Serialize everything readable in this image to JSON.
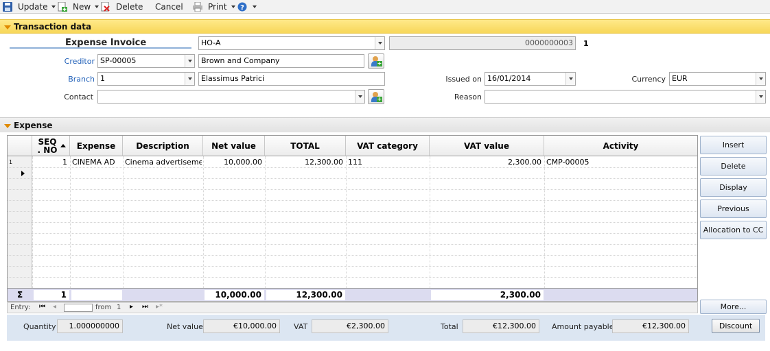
{
  "toolbar": {
    "update_label": "Update",
    "new_label": "New",
    "delete_label": "Delete",
    "cancel_label": "Cancel",
    "print_label": "Print"
  },
  "sections": {
    "transaction": "Transaction data",
    "expense": "Expense"
  },
  "form": {
    "doc_type": "Expense Invoice",
    "series_value": "HO-A",
    "doc_number": "0000000003",
    "doc_number_suffix": "1",
    "creditor_label": "Creditor",
    "creditor_code": "SP-00005",
    "creditor_name": "Brown and Company",
    "branch_label": "Branch",
    "branch_code": "1",
    "branch_name": "Elassimus Patrici",
    "contact_label": "Contact",
    "contact_value": "",
    "issued_on_label": "Issued on",
    "issued_on_value": "16/01/2014",
    "currency_label": "Currency",
    "currency_value": "EUR",
    "reason_label": "Reason",
    "reason_value": ""
  },
  "grid": {
    "columns": [
      "SEQ . NO",
      "Expense",
      "Description",
      "Net value",
      "TOTAL",
      "VAT category",
      "VAT value",
      "Activity"
    ],
    "rows": [
      {
        "row_num": "1",
        "seq": "1",
        "expense": "CINEMA AD",
        "description": "Cinema advertisement",
        "net_value": "10,000.00",
        "total": "12,300.00",
        "vat_category": "111",
        "vat_value": "2,300.00",
        "activity": "CMP-00005"
      }
    ],
    "totals": {
      "sigma": "Σ",
      "seq": "1",
      "net_value": "10,000.00",
      "total": "12,300.00",
      "vat_value": "2,300.00"
    }
  },
  "side_buttons": {
    "insert": "Insert",
    "delete": "Delete",
    "display": "Display",
    "previous": "Previous",
    "allocation": "Allocation to CC",
    "more": "More..."
  },
  "navigator": {
    "entry_label": "Entry:",
    "from_label": "from",
    "count": "1"
  },
  "footer": {
    "quantity_label": "Quantity",
    "quantity_value": "1.000000000",
    "net_label": "Net value",
    "net_value": "€10,000.00",
    "vat_label": "VAT",
    "vat_value": "€2,300.00",
    "total_label": "Total",
    "total_value": "€12,300.00",
    "payable_label": "Amount payable",
    "payable_value": "€12,300.00",
    "discount_label": "Discount"
  }
}
